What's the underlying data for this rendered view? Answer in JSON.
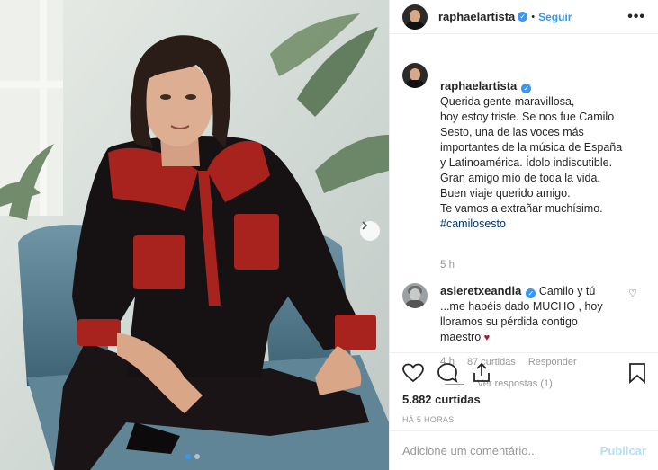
{
  "post": {
    "author": "raphaelartista",
    "follow_label": "Seguir",
    "separator": "•",
    "more_label": "•••",
    "verified_mark": "✓"
  },
  "caption": {
    "author": "raphaelartista",
    "text": "Querida gente maravillosa,\nhoy estoy triste. Se nos fue Camilo Sesto, una de las voces más importantes de la música de España y Latinoamérica. Ídolo indiscutible. Gran amigo mío de toda la vida. Buen viaje querido amigo.\nTe vamos a extrañar muchísimo.",
    "hashtag": "#camilosesto",
    "time": "5 h"
  },
  "comment": {
    "author": "asieretxeandia",
    "text": "Camilo y tú ...me habéis dado MUCHO , hoy lloramos su pérdida contigo maestro",
    "heart": "♥",
    "time": "4 h",
    "likes": "87 curtidas",
    "reply_label": "Responder",
    "view_replies": "Ver respostas (1)",
    "like_icon": "♡"
  },
  "stats": {
    "likes": "5.882 curtidas",
    "time": "HÁ 5 HORAS"
  },
  "composer": {
    "placeholder": "Adicione um comentário...",
    "publish_label": "Publicar"
  },
  "carousel": {
    "next_icon": "chevron-right-icon",
    "current_slide": 1,
    "total_slides": 2
  },
  "colors": {
    "accent": "#3897f0",
    "publish_disabled": "#b2dffc",
    "hashtag": "#003569",
    "heart_red": "#c0112b"
  }
}
